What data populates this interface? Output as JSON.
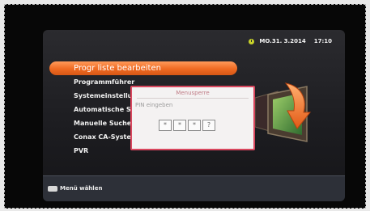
{
  "status": {
    "date": "MO.31. 3.2014",
    "time": "17:10",
    "icon": "clock-icon",
    "icon_color": "#c8d22a"
  },
  "menu": {
    "items": [
      {
        "label": "Progr liste bearbeiten",
        "selected": true
      },
      {
        "label": "Programmführer"
      },
      {
        "label": "Systemeinstellung"
      },
      {
        "label": "Automatische Suc"
      },
      {
        "label": "Manuelle Suche"
      },
      {
        "label": "Conax CA-System"
      },
      {
        "label": "PVR"
      }
    ],
    "selected_color": "#ef6a22"
  },
  "dialog": {
    "title": "Menusperre",
    "prompt": "PIN eingeben",
    "pin": [
      "*",
      "*",
      "*",
      "?"
    ],
    "border_color": "#d9475e"
  },
  "footer": {
    "hint": "Menü wählen",
    "key_icon": "ok-key-icon"
  }
}
